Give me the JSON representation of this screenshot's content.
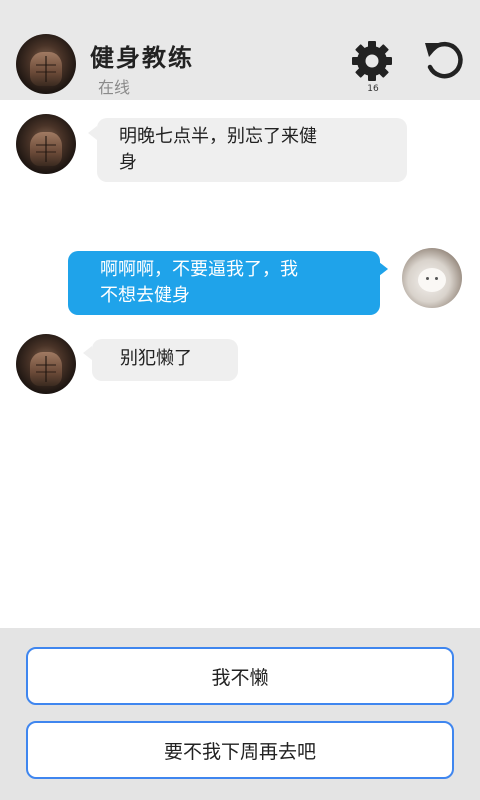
{
  "header": {
    "title": "健身教练",
    "status": "在线",
    "settings_count": "16"
  },
  "messages": [
    {
      "side": "left",
      "sender": "coach",
      "line1": "明晚七点半，别忘了来健",
      "line2": "身"
    },
    {
      "side": "right",
      "sender": "me",
      "line1": "啊啊啊，不要逼我了，我",
      "line2": "不想去健身"
    },
    {
      "side": "left",
      "sender": "coach",
      "line1": "别犯懒了"
    }
  ],
  "choices": [
    {
      "label": "我不懒"
    },
    {
      "label": "要不我下周再去吧"
    }
  ],
  "colors": {
    "header_bg": "#e8e8e8",
    "outgoing_bubble": "#1fa3ea",
    "incoming_bubble": "#efefef",
    "choice_border": "#3f86ef",
    "footer_bg": "#e4e4e4"
  },
  "icons": {
    "settings": "gear-icon",
    "reset": "undo-icon"
  }
}
